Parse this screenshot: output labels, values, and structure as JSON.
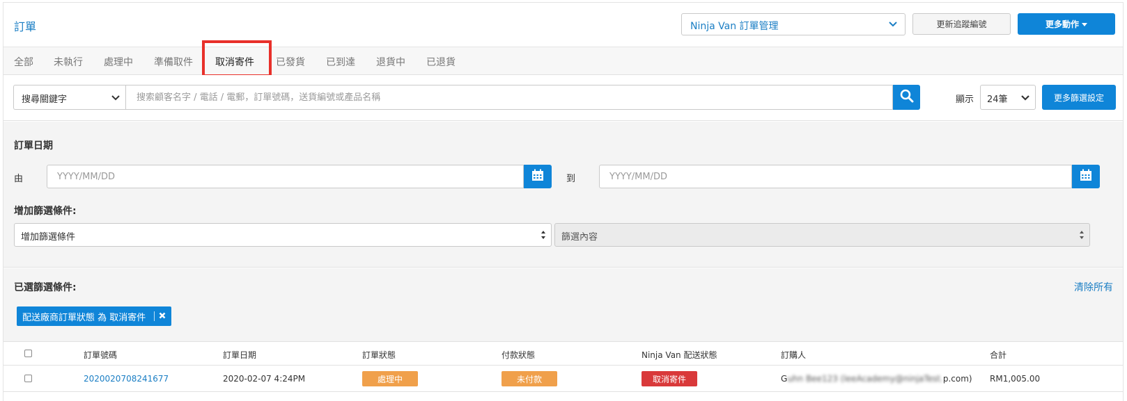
{
  "header": {
    "title": "訂單",
    "carrier_select": "Ninja Van 訂單管理",
    "update_tracking_btn": "更新追蹤編號",
    "more_actions_btn": "更多動作"
  },
  "tabs": [
    {
      "label": "全部"
    },
    {
      "label": "未執行"
    },
    {
      "label": "處理中"
    },
    {
      "label": "準備取件"
    },
    {
      "label": "取消寄件",
      "active": true
    },
    {
      "label": "已發貨"
    },
    {
      "label": "已到達"
    },
    {
      "label": "退貨中"
    },
    {
      "label": "已退貨"
    }
  ],
  "search": {
    "keyword_select": "搜尋關鍵字",
    "placeholder": "搜索顧客名字 / 電話 / 電郵，訂單號碼，送貨編號或產品名稱",
    "show_label": "顯示",
    "page_size": "24筆",
    "more_filters_btn": "更多篩選設定"
  },
  "filters": {
    "date_title": "訂單日期",
    "from_label": "由",
    "to_label": "到",
    "from_placeholder": "YYYY/MM/DD",
    "to_placeholder": "YYYY/MM/DD",
    "add_condition_title": "增加篩選條件:",
    "condition_select": "增加篩選條件",
    "condition_value_select": "篩選內容"
  },
  "selected_filters": {
    "title": "已選篩選條件:",
    "clear_all": "清除所有",
    "chips": [
      {
        "label": "配送廠商訂單狀態 為 取消寄件"
      }
    ]
  },
  "table": {
    "columns": [
      "訂單號碼",
      "訂單日期",
      "訂單狀態",
      "付款狀態",
      "Ninja Van 配送狀態",
      "訂購人",
      "合計"
    ],
    "rows": [
      {
        "order_no": "2020020708241677",
        "date": "2020-02-07 4:24PM",
        "order_status": "處理中",
        "payment_status": "未付款",
        "delivery_status": "取消寄件",
        "customer_prefix": "G",
        "customer_blurred": "uhn Bee123 (leeAcademy@ninjaTest.",
        "customer_suffix": "p.com)",
        "total": "RM1,005.00"
      }
    ]
  },
  "colors": {
    "primary": "#0f85d8",
    "link": "#1a7ec4",
    "processing": "#f0a04b",
    "unpaid": "#f0a04b",
    "cancelled": "#d9393a",
    "highlight": "#e8302a"
  }
}
